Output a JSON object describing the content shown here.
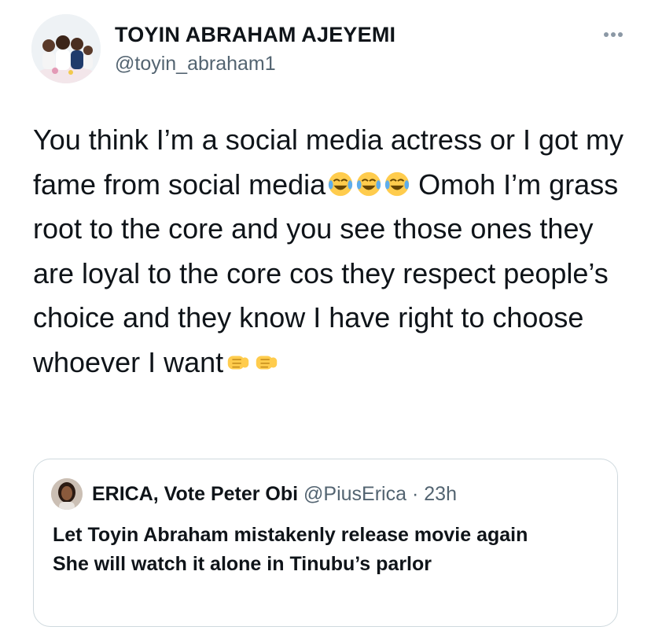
{
  "tweet": {
    "author": {
      "display_name": "TOYIN ABRAHAM AJEYEMI",
      "handle": "@toyin_abraham1",
      "avatar_icon": "profile-photo-family"
    },
    "more_icon": "ellipsis-icon",
    "text": "You think I’m a social media actress or I got my fame from social media",
    "text_emoji": "😂😂😂",
    "text_rest": " Omoh I’m grass root to the core and you see those ones they are loyal to the core cos they respect people’s choice and they know I have right to choose whoever I want",
    "text_end_emoji": "🤜🤜"
  },
  "quote": {
    "display_name": "ERICA, Vote Peter Obi",
    "handle": "@PiusErica",
    "separator": "·",
    "time": "23h",
    "text": "Let Toyin Abraham mistakenly release movie again\nShe will watch it alone in Tinubu’s parlor"
  },
  "colors": {
    "text": "#0f1419",
    "secondary": "#536471",
    "border": "#cfd9de",
    "background": "#ffffff"
  }
}
